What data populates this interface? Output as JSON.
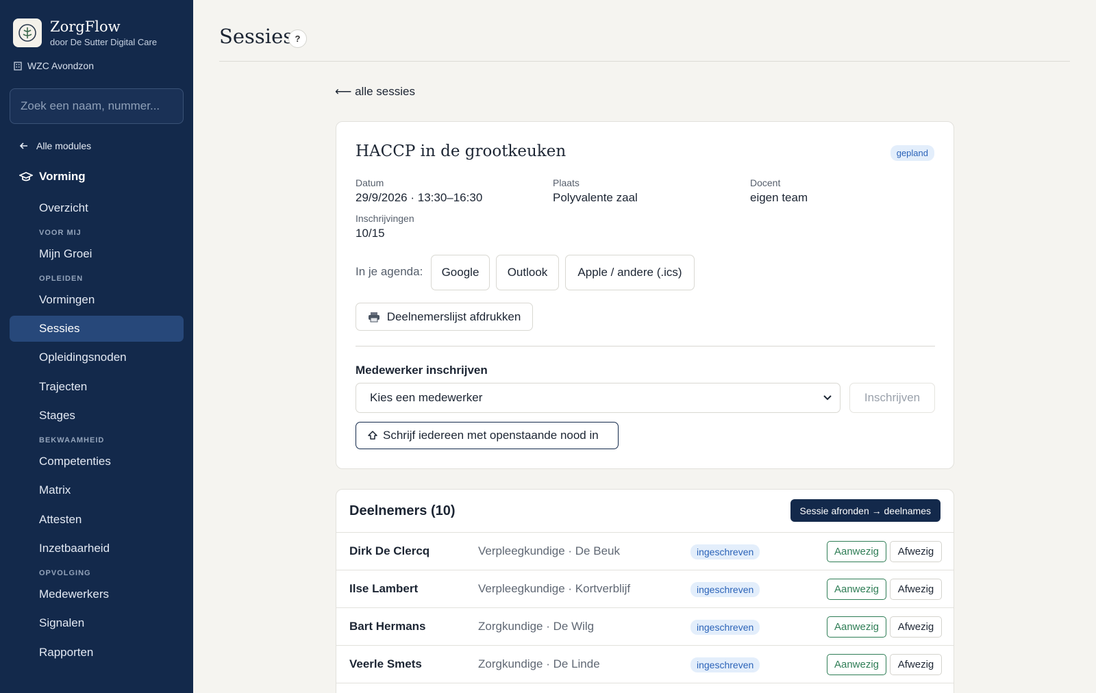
{
  "brand": {
    "name": "ZorgFlow",
    "subtitle": "door De Sutter Digital Care",
    "org": "WZC Avondzon"
  },
  "search": {
    "placeholder": "Zoek een naam, nummer..."
  },
  "sidebar": {
    "back_label": "Alle modules",
    "module_label": "Vorming",
    "items": [
      {
        "label": "Overzicht"
      },
      {
        "group": "VOOR MIJ"
      },
      {
        "label": "Mijn Groei"
      },
      {
        "group": "OPLEIDEN"
      },
      {
        "label": "Vormingen"
      },
      {
        "label": "Sessies",
        "active": true
      },
      {
        "label": "Opleidingsnoden"
      },
      {
        "label": "Trajecten"
      },
      {
        "label": "Stages"
      },
      {
        "group": "BEKWAAMHEID"
      },
      {
        "label": "Competenties"
      },
      {
        "label": "Matrix"
      },
      {
        "label": "Attesten"
      },
      {
        "label": "Inzetbaarheid"
      },
      {
        "group": "OPVOLGING"
      },
      {
        "label": "Medewerkers"
      },
      {
        "label": "Signalen"
      },
      {
        "label": "Rapporten"
      }
    ]
  },
  "page": {
    "title": "Sessies",
    "help": "?",
    "back_link": "⟵ alle sessies"
  },
  "session": {
    "title": "HACCP in de grootkeuken",
    "status": "gepland",
    "fields": {
      "datum": {
        "label": "Datum",
        "value": "29/9/2026 · 13:30–16:30"
      },
      "plaats": {
        "label": "Plaats",
        "value": "Polyvalente zaal"
      },
      "docent": {
        "label": "Docent",
        "value": "eigen team"
      },
      "inschrijvingen": {
        "label": "Inschrijvingen",
        "value": "10/15"
      }
    },
    "agenda_label": "In je agenda:",
    "agenda_buttons": {
      "google": "Google",
      "outlook": "Outlook",
      "apple": "Apple / andere (.ics)"
    },
    "print_label": "Deelnemerslijst afdrukken",
    "enroll_label": "Medewerker inschrijven",
    "select_value": "Kies een medewerker",
    "enroll_button": "Inschrijven",
    "enroll_all_button": "Schrijf iedereen met openstaande nood in"
  },
  "participants": {
    "title": "Deelnemers (10)",
    "finish_button": "Sessie afronden → deelnames",
    "present_label": "Aanwezig",
    "absent_label": "Afwezig",
    "rows": [
      {
        "name": "Dirk De Clercq",
        "role": "Verpleegkundige · De Beuk",
        "status": "ingeschreven"
      },
      {
        "name": "Ilse Lambert",
        "role": "Verpleegkundige · Kortverblijf",
        "status": "ingeschreven"
      },
      {
        "name": "Bart Hermans",
        "role": "Zorgkundige · De Wilg",
        "status": "ingeschreven"
      },
      {
        "name": "Veerle Smets",
        "role": "Zorgkundige · De Linde",
        "status": "ingeschreven"
      }
    ]
  }
}
